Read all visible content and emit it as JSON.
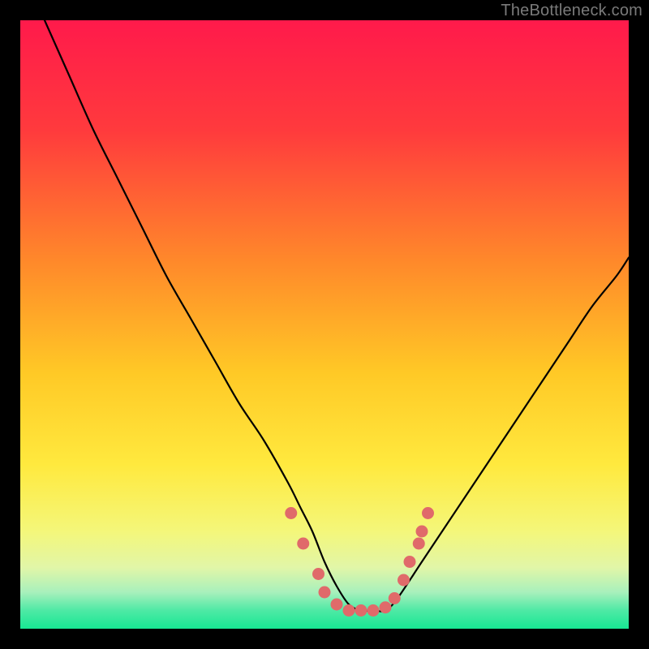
{
  "watermark": {
    "text": "TheBottleneck.com"
  },
  "chart_data": {
    "type": "line",
    "title": "",
    "xlabel": "",
    "ylabel": "",
    "xlim": [
      0,
      100
    ],
    "ylim": [
      0,
      100
    ],
    "gradient_stops": [
      {
        "offset": 0,
        "color": "#ff1a4b"
      },
      {
        "offset": 18,
        "color": "#ff3a3d"
      },
      {
        "offset": 40,
        "color": "#ff8a2a"
      },
      {
        "offset": 58,
        "color": "#ffc926"
      },
      {
        "offset": 73,
        "color": "#ffe93e"
      },
      {
        "offset": 84,
        "color": "#f4f77a"
      },
      {
        "offset": 90,
        "color": "#e1f6a8"
      },
      {
        "offset": 94,
        "color": "#a8f0bc"
      },
      {
        "offset": 97,
        "color": "#4ee9a5"
      },
      {
        "offset": 100,
        "color": "#17e893"
      }
    ],
    "series": [
      {
        "name": "bottleneck-curve",
        "color": "#000000",
        "x": [
          4,
          8,
          12,
          16,
          20,
          24,
          28,
          32,
          36,
          40,
          44,
          46,
          48,
          50,
          52,
          54,
          56,
          58,
          60,
          62,
          66,
          70,
          74,
          78,
          82,
          86,
          90,
          94,
          98,
          100
        ],
        "y": [
          100,
          91,
          82,
          74,
          66,
          58,
          51,
          44,
          37,
          31,
          24,
          20,
          16,
          11,
          7,
          4,
          3,
          3,
          3,
          5,
          11,
          17,
          23,
          29,
          35,
          41,
          47,
          53,
          58,
          61
        ]
      }
    ],
    "markers": {
      "name": "curve-dots",
      "color": "#e06a6a",
      "points": [
        {
          "x": 44.5,
          "y": 19
        },
        {
          "x": 46.5,
          "y": 14
        },
        {
          "x": 49,
          "y": 9
        },
        {
          "x": 50,
          "y": 6
        },
        {
          "x": 52,
          "y": 4
        },
        {
          "x": 54,
          "y": 3
        },
        {
          "x": 56,
          "y": 3
        },
        {
          "x": 58,
          "y": 3
        },
        {
          "x": 60,
          "y": 3.5
        },
        {
          "x": 61.5,
          "y": 5
        },
        {
          "x": 63,
          "y": 8
        },
        {
          "x": 64,
          "y": 11
        },
        {
          "x": 65.5,
          "y": 14
        },
        {
          "x": 66,
          "y": 16
        },
        {
          "x": 67,
          "y": 19
        }
      ]
    }
  }
}
